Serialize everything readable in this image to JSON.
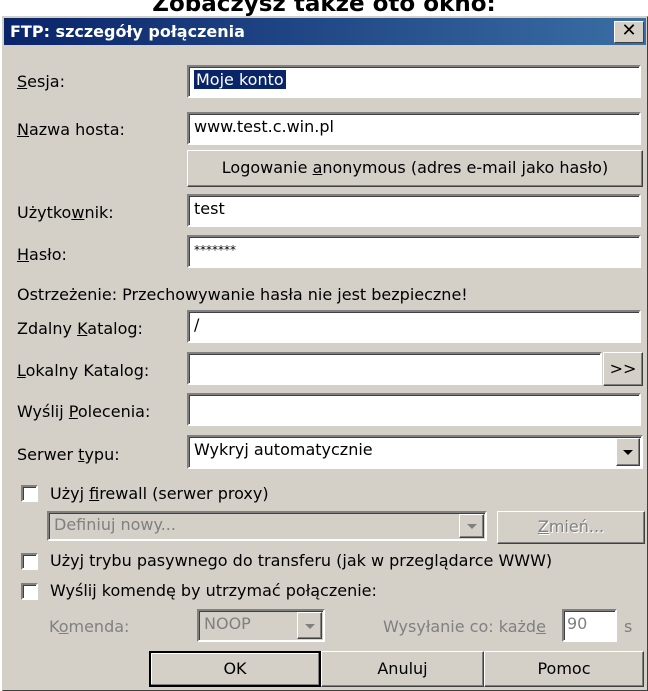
{
  "caption": "Zobaczysz także oto okno:",
  "window": {
    "title": "FTP: szczegóły połączenia",
    "close_glyph": "✕"
  },
  "fields": {
    "session": {
      "label_pre": "",
      "label_u": "S",
      "label_post": "esja:",
      "value": "Moje konto"
    },
    "host": {
      "label_pre": "",
      "label_u": "N",
      "label_post": "azwa hosta:",
      "value": "www.test.c.win.pl"
    },
    "anon_button": {
      "pre": "Logowanie ",
      "u": "a",
      "post": "nonymous (adres e-mail jako hasło)"
    },
    "user": {
      "label_pre": "Użytko",
      "label_u": "w",
      "label_post": "nik:",
      "value": "test"
    },
    "password": {
      "label_pre": "",
      "label_u": "H",
      "label_post": "asło:",
      "value": "*******"
    },
    "warning": "Ostrzeżenie: Przechowywanie hasła nie jest bezpieczne!",
    "remote_dir": {
      "label_pre": "Zdalny ",
      "label_u": "K",
      "label_post": "atalog:",
      "value": "/"
    },
    "local_dir": {
      "label_pre": "",
      "label_u": "L",
      "label_post": "okalny Katalog:",
      "value": "",
      "browse": ">>"
    },
    "commands": {
      "label_pre": "Wyślij ",
      "label_u": "P",
      "label_post": "olecenia:",
      "value": ""
    },
    "server_type": {
      "label_pre": "Serwer ",
      "label_u": "t",
      "label_post": "ypu:",
      "value": "Wykryj automatycznie"
    }
  },
  "firewall": {
    "checked": false,
    "label_pre": "Użyj ",
    "label_u": "f",
    "label_post": "irewall (serwer proxy)",
    "select_value": "Definiuj nowy...",
    "change_u": "Z",
    "change_post": "mień..."
  },
  "passive": {
    "checked": false,
    "label": "Użyj trybu pasywnego do transferu (jak w przeglądarce WWW)"
  },
  "keepalive": {
    "checked": false,
    "label": "Wyślij komendę by utrzymać połączenie:",
    "command_label_pre": "K",
    "command_label_u": "o",
    "command_label_post": "menda:",
    "command_value": "NOOP",
    "interval_label_pre": "Wysyłanie co: każd",
    "interval_label_u": "e",
    "interval_value": "90",
    "interval_unit": "s"
  },
  "buttons": {
    "ok": "OK",
    "cancel": "Anuluj",
    "help": "Pomoc"
  }
}
